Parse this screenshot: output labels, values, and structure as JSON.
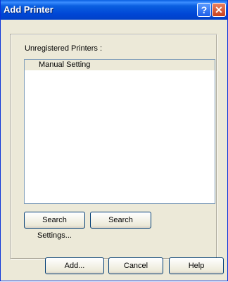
{
  "window": {
    "title": "Add Printer",
    "help_glyph": "?",
    "close_glyph": "✕"
  },
  "main": {
    "list_label": "Unregistered Printers :",
    "list_items": [
      {
        "label": "Manual Setting"
      }
    ],
    "search_settings_label": "Search Settings...",
    "search_label": "Search"
  },
  "footer": {
    "add_label": "Add...",
    "cancel_label": "Cancel",
    "help_label": "Help"
  }
}
